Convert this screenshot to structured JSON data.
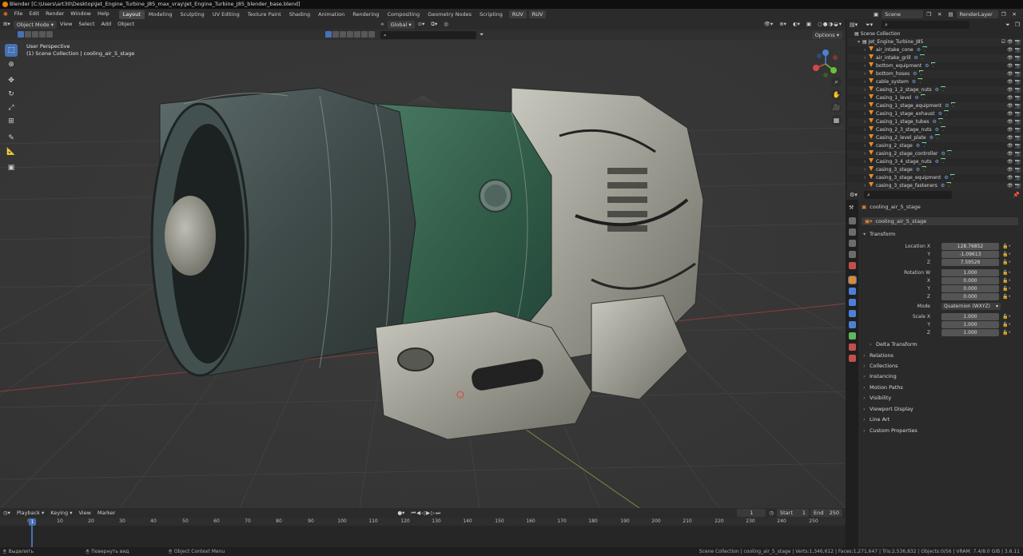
{
  "window": {
    "title": "Blender [C:\\Users\\art30\\Desktop\\Jet_Engine_Turbine_J85_max_vray\\Jet_Engine_Turbine_J85_blender_base.blend]"
  },
  "menu": {
    "items": [
      "File",
      "Edit",
      "Render",
      "Window",
      "Help"
    ],
    "workspaces": [
      "Layout",
      "Modeling",
      "Sculpting",
      "UV Editing",
      "Texture Paint",
      "Shading",
      "Animation",
      "Rendering",
      "Compositing",
      "Geometry Nodes",
      "Scripting"
    ],
    "active_workspace": "Layout",
    "uv_buttons": [
      "RUV",
      "RUV"
    ],
    "scene": "Scene",
    "view_layer": "RenderLayer"
  },
  "viewport_header": {
    "mode": "Object Mode",
    "menus": [
      "View",
      "Select",
      "Add",
      "Object"
    ],
    "transform_orientation": "Global",
    "options": "Options"
  },
  "viewport": {
    "perspective": "User Perspective",
    "context": "(1) Scene Collection | cooling_air_5_stage",
    "accent": "#4772b3"
  },
  "timeline": {
    "menus": [
      "Playback",
      "Keying",
      "View",
      "Marker"
    ],
    "current_frame": "1",
    "start_label": "Start",
    "start": "1",
    "end_label": "End",
    "end": "250",
    "ticks": [
      "0",
      "10",
      "20",
      "30",
      "40",
      "50",
      "60",
      "70",
      "80",
      "90",
      "100",
      "110",
      "120",
      "130",
      "140",
      "150",
      "160",
      "170",
      "180",
      "190",
      "200",
      "210",
      "220",
      "230",
      "240",
      "250"
    ],
    "playhead": "1"
  },
  "statusbar": {
    "select": "Выделить",
    "rotate": "Повернуть вид",
    "context_menu": "Object Context Menu",
    "stats": "Scene Collection | cooling_air_5_stage | Verts:1,346,612 | Faces:1,271,647 | Tris:2,536,832 | Objects:0/56 | VRAM: 7.4/8.0 GiB | 3.6.11"
  },
  "outliner": {
    "root": "Scene Collection",
    "collection": "Jet_Engine_Turbine_J85",
    "items": [
      "air_intake_cone",
      "air_intake_grill",
      "bottom_equipment",
      "bottom_hoses",
      "cable_system",
      "Casing_1_2_stage_nuts",
      "Casing_1_level",
      "Casing_1_stage_equipment",
      "Casing_1_stage_exhaust",
      "Casing_1_stage_tubes",
      "Casing_2_3_stage_nuts",
      "Casing_2_level_plate",
      "casing_2_stage",
      "casing_2_stage_controller",
      "Casing_3_4_stage_nuts",
      "casing_3_stage",
      "casing_3_stage_equipment",
      "casing_3_stage_fasteners"
    ]
  },
  "properties": {
    "object_name": "cooling_air_5_stage",
    "data_name": "cooling_air_5_stage",
    "transform_label": "Transform",
    "location_label": "Location X",
    "location": [
      "128.76852",
      "-1.09613",
      "7.59526"
    ],
    "rotation_label": "Rotation W",
    "rotation": [
      "1.000",
      "0.000",
      "0.000",
      "0.000"
    ],
    "mode_label": "Mode",
    "mode": "Quaternion (WXYZ)",
    "scale_label": "Scale X",
    "scale": [
      "1.000",
      "1.000",
      "1.000"
    ],
    "axis_labels": [
      "Y",
      "Z",
      "X"
    ],
    "delta": "Delta Transform",
    "panels": [
      "Relations",
      "Collections",
      "Instancing",
      "Motion Paths",
      "Visibility",
      "Viewport Display",
      "Line Art",
      "Custom Properties"
    ]
  }
}
